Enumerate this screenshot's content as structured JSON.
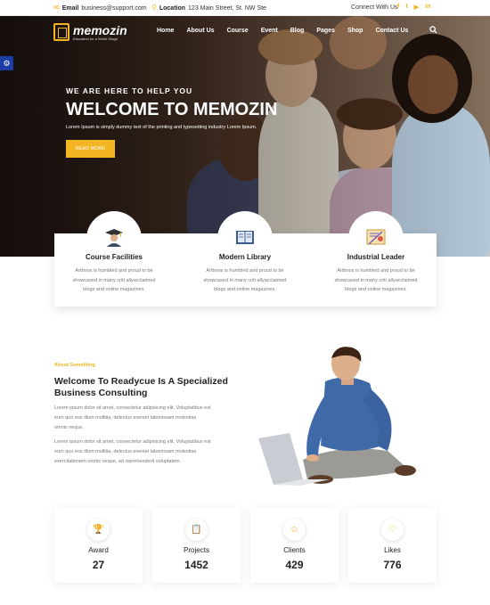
{
  "topbar": {
    "email_label": "Email",
    "email_value": "business@support.com",
    "location_label": "Location",
    "location_value": "123 Main Street, St. NW Ste",
    "connect_label": "Connect With Us",
    "social_icons": [
      "facebook-icon",
      "twitter-icon",
      "youtube-icon",
      "linkedin-icon"
    ]
  },
  "brand": {
    "name": "memozin",
    "tagline": "Education for a World Stage"
  },
  "nav": {
    "items": [
      "Home",
      "About Us",
      "Course",
      "Event",
      "Blog",
      "Pages",
      "Shop",
      "Contact Us"
    ]
  },
  "hero": {
    "eyebrow": "WE ARE HERE TO HELP YOU",
    "title": "WELCOME TO MEMOZIN",
    "subtitle": "Lorem Ipsum is simply dummy text of the printing and typesetting industry Lorem Ipsum.",
    "button": "READ MORE"
  },
  "features": [
    {
      "title": "Course Facilities",
      "desc": [
        "Artboos is humbled and proud to be",
        "showcased in many criti allyacclaimed",
        "blogs and online magazines."
      ],
      "icon": "graduate-icon"
    },
    {
      "title": "Modern Library",
      "desc": [
        "Artboos is humbled and proud to be",
        "showcased in many criti allyacclaimed",
        "blogs and online magazines."
      ],
      "icon": "book-icon"
    },
    {
      "title": "Industrial Leader",
      "desc": [
        "Artboos is humbled and proud to be",
        "showcased in many criti allyacclaimed",
        "blogs and online magazines."
      ],
      "icon": "certificate-icon"
    }
  ],
  "about": {
    "eyebrow": "About Something",
    "title_line1": "Welcome To Readycue Is A Specialized",
    "title_line2": "Business Consulting",
    "para1": [
      "Lorem ipsum dolor sit amet, consectetur adipisicing elit. Voluptatibus est",
      "eum quo eos illum mollitia, delectus eveniet laboriosam molestias",
      "omnis neque."
    ],
    "para2": [
      "Lorem ipsum dolor sit amet, consectetur adipisicing elit. Voluptatibus est",
      "eum quo eos illum mollitia, delectus eveniet laboriosam molestias",
      "exercitationem omnis neque, ad reprehenderit voluptatem."
    ]
  },
  "stats": [
    {
      "label": "Award",
      "value": "27",
      "icon": "trophy-icon"
    },
    {
      "label": "Projects",
      "value": "1452",
      "icon": "clipboard-icon"
    },
    {
      "label": "Clients",
      "value": "429",
      "icon": "smile-icon"
    },
    {
      "label": "Likes",
      "value": "776",
      "icon": "heart-icon"
    }
  ],
  "colors": {
    "accent": "#f3b521",
    "settings_tab": "#1b3ea6"
  }
}
